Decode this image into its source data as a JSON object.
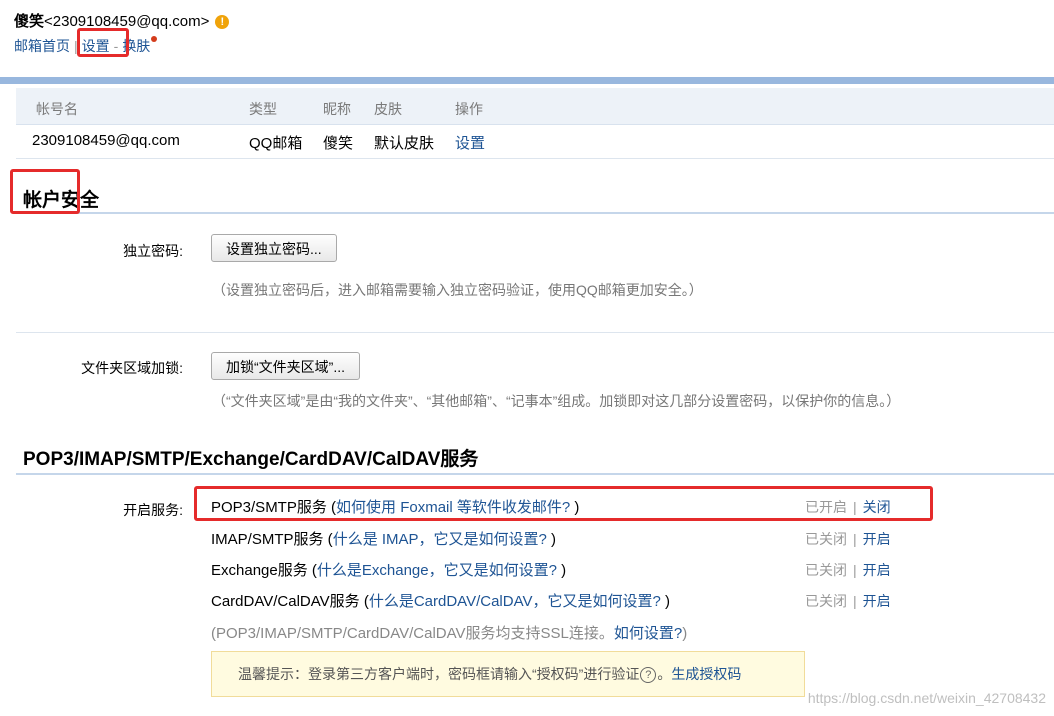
{
  "header": {
    "user_name": "傻笑",
    "user_email": "<2309108459@qq.com>",
    "warn_symbol": "!",
    "nav": {
      "home": "邮箱首页",
      "sep": "|",
      "settings": "设置",
      "dash": "-",
      "skin": "换肤"
    }
  },
  "account_table": {
    "headers": {
      "account": "帐号名",
      "type": "类型",
      "nickname": "昵称",
      "skin": "皮肤",
      "action": "操作"
    },
    "row": {
      "account": "2309108459@qq.com",
      "type": "QQ邮箱",
      "nickname": "傻笑",
      "skin": "默认皮肤",
      "action": "设置"
    }
  },
  "security": {
    "title": "帐户安全",
    "password_label": "独立密码:",
    "password_button": "设置独立密码...",
    "password_note": "（设置独立密码后，进入邮箱需要输入独立密码验证，使用QQ邮箱更加安全。）",
    "lock_label": "文件夹区域加锁:",
    "lock_button": "加锁“文件夹区域”...",
    "lock_note": "（“文件夹区域”是由“我的文件夹”、“其他邮箱”、“记事本”组成。加锁即对这几部分设置密码，以保护你的信息。）"
  },
  "services": {
    "title": "POP3/IMAP/SMTP/Exchange/CardDAV/CalDAV服务",
    "open_label": "开启服务:",
    "items": [
      {
        "name": "POP3/SMTP服务",
        "open": " (",
        "link": "如何使用 Foxmail 等软件收发邮件?",
        "close": " )",
        "status": "已开启",
        "sep": "|",
        "action": "关闭"
      },
      {
        "name": "IMAP/SMTP服务",
        "open": " (",
        "link": "什么是 IMAP，它又是如何设置?",
        "close": " )",
        "status": "已关闭",
        "sep": "|",
        "action": "开启"
      },
      {
        "name": "Exchange服务",
        "open": " (",
        "link": "什么是Exchange，它又是如何设置?",
        "close": " )",
        "status": "已关闭",
        "sep": "|",
        "action": "开启"
      },
      {
        "name": "CardDAV/CalDAV服务",
        "open": " (",
        "link": "什么是CardDAV/CalDAV，它又是如何设置?",
        "close": " )",
        "status": "已关闭",
        "sep": "|",
        "action": "开启"
      }
    ],
    "ssl_note": "(POP3/IMAP/SMTP/CardDAV/CalDAV服务均支持SSL连接。",
    "ssl_link": "如何设置?",
    "ssl_close": ")",
    "tip_text": "温馨提示：登录第三方客户端时，密码框请输入“授权码”进行验证",
    "tip_q": "?",
    "tip_link": "生成授权码"
  },
  "watermark": "https://blog.csdn.net/weixin_42708432"
}
